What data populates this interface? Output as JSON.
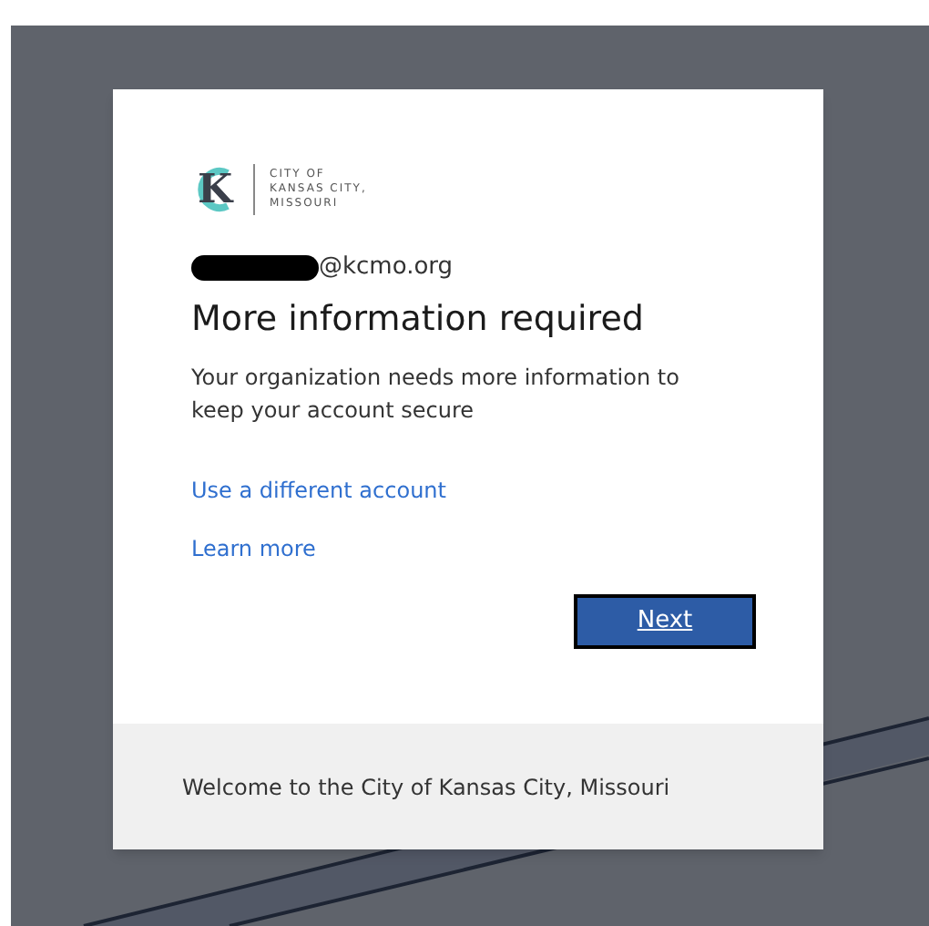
{
  "logo": {
    "mark": "K",
    "lines": [
      "CITY OF",
      "KANSAS CITY,",
      "MISSOURI"
    ]
  },
  "account": {
    "email": "@kcmo.org",
    "redacted": true
  },
  "title": "More information required",
  "message": "Your organization needs more information to keep your account secure",
  "links": [
    "Use a different account",
    "Learn more"
  ],
  "primary_button": "Next",
  "footer": "Welcome to the City of Kansas City, Missouri"
}
